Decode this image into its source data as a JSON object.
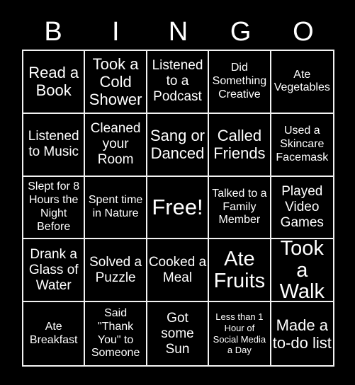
{
  "card": {
    "title": "BINGO",
    "background_color": "#000000",
    "text_color": "#ffffff",
    "border_color": "#f2f2f2"
  },
  "header": {
    "letters": [
      "B",
      "I",
      "N",
      "G",
      "O"
    ]
  },
  "grid": {
    "columns": 5,
    "rows": 5,
    "cells": [
      {
        "text": "Read a Book",
        "size": "t-lg"
      },
      {
        "text": "Took a Cold Shower",
        "size": "t-lg"
      },
      {
        "text": "Listened to a Podcast",
        "size": "t-md"
      },
      {
        "text": "Did Something Creative",
        "size": "t-sm"
      },
      {
        "text": "Ate Vegetables",
        "size": "t-sm"
      },
      {
        "text": "Listened to Music",
        "size": "t-md"
      },
      {
        "text": "Cleaned your Room",
        "size": "t-md"
      },
      {
        "text": "Sang or Danced",
        "size": "t-lg"
      },
      {
        "text": "Called Friends",
        "size": "t-lg"
      },
      {
        "text": "Used a Skincare Facemask",
        "size": "t-sm"
      },
      {
        "text": "Slept for 8 Hours the Night Before",
        "size": "t-sm"
      },
      {
        "text": "Spent time in Nature",
        "size": "t-sm"
      },
      {
        "text": "Free!",
        "size": "t-free"
      },
      {
        "text": "Talked to a Family Member",
        "size": "t-sm"
      },
      {
        "text": "Played Video Games",
        "size": "t-md"
      },
      {
        "text": "Drank a Glass of Water",
        "size": "t-md"
      },
      {
        "text": "Solved a Puzzle",
        "size": "t-md"
      },
      {
        "text": "Cooked a Meal",
        "size": "t-md"
      },
      {
        "text": "Ate Fruits",
        "size": "t-xl"
      },
      {
        "text": "Took a Walk",
        "size": "t-xl"
      },
      {
        "text": "Ate Breakfast",
        "size": "t-sm"
      },
      {
        "text": "Said \"Thank You\" to Someone",
        "size": "t-sm"
      },
      {
        "text": "Got some Sun",
        "size": "t-md"
      },
      {
        "text": "Less than 1 Hour of Social Media a Day",
        "size": "t-xs"
      },
      {
        "text": "Made a to-do list",
        "size": "t-lg"
      }
    ]
  }
}
